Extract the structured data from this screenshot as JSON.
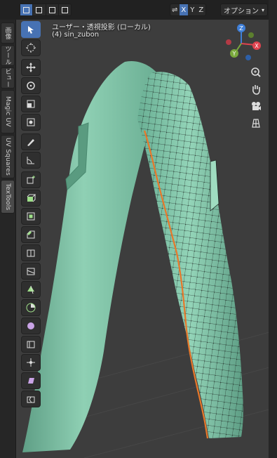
{
  "header": {
    "axes": [
      "X",
      "Y",
      "Z"
    ],
    "options_label": "オプション"
  },
  "viewport": {
    "view_label": "ユーザー・透視投影 (ローカル)",
    "object_label": "(4) sin_zubon"
  },
  "sidebar_tabs": [
    "画像",
    "ツール",
    "ビュー",
    "Magic UV",
    "UV Squares",
    "TexTools"
  ],
  "toolbar_tools": [
    "select-box-icon",
    "cursor-icon",
    "move-icon",
    "rotate-icon",
    "scale-icon",
    "transform-icon",
    "annotate-icon",
    "measure-icon",
    "add-cube-icon",
    "extrude-region-icon",
    "inset-faces-icon",
    "bevel-icon",
    "loop-cut-icon",
    "knife-icon",
    "poly-build-icon",
    "spin-icon",
    "smooth-icon",
    "edge-slide-icon",
    "shrink-fatten-icon",
    "shear-icon",
    "rip-region-icon"
  ],
  "gizmo": {
    "axes": [
      "X",
      "Y",
      "Z"
    ],
    "colors": {
      "x": "#e0434f",
      "y": "#7aa93c",
      "z": "#3f7fd8"
    }
  },
  "colors": {
    "accent": "#4772b3",
    "mesh": "#7fc4a6",
    "seam": "#e8782a"
  }
}
